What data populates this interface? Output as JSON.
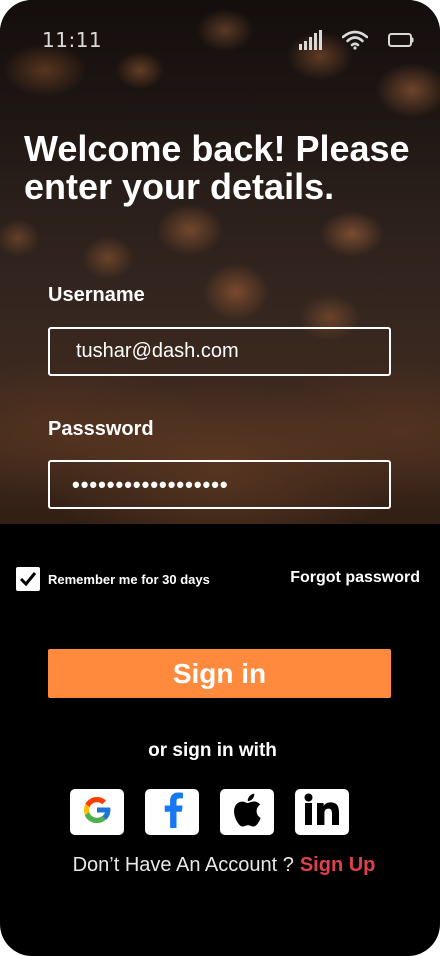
{
  "status_bar": {
    "time": "11:11",
    "icons": [
      "signal-icon",
      "wifi-icon",
      "battery-icon"
    ]
  },
  "page": {
    "title": "Welcome back! Please enter your details."
  },
  "form": {
    "username_label": "Username",
    "username_value": "tushar@dash.com",
    "password_label": "Passsword",
    "password_value": "••••••••••••••••••",
    "remember_label": "Remember me for 30 days",
    "remember_checked": true,
    "forgot_label": "Forgot password",
    "sign_in_label": "Sign in"
  },
  "social": {
    "label": "or sign in with",
    "providers": [
      {
        "name": "google",
        "icon": "google-icon"
      },
      {
        "name": "facebook",
        "icon": "facebook-icon"
      },
      {
        "name": "apple",
        "icon": "apple-icon"
      },
      {
        "name": "linkedin",
        "icon": "linkedin-icon"
      }
    ]
  },
  "signup": {
    "prompt": "Don’t Have An Account ?",
    "link": "Sign Up"
  },
  "colors": {
    "background": "#000000",
    "accent": "#ff8a3d",
    "signup_link": "#e0404a",
    "text": "#ffffff"
  }
}
